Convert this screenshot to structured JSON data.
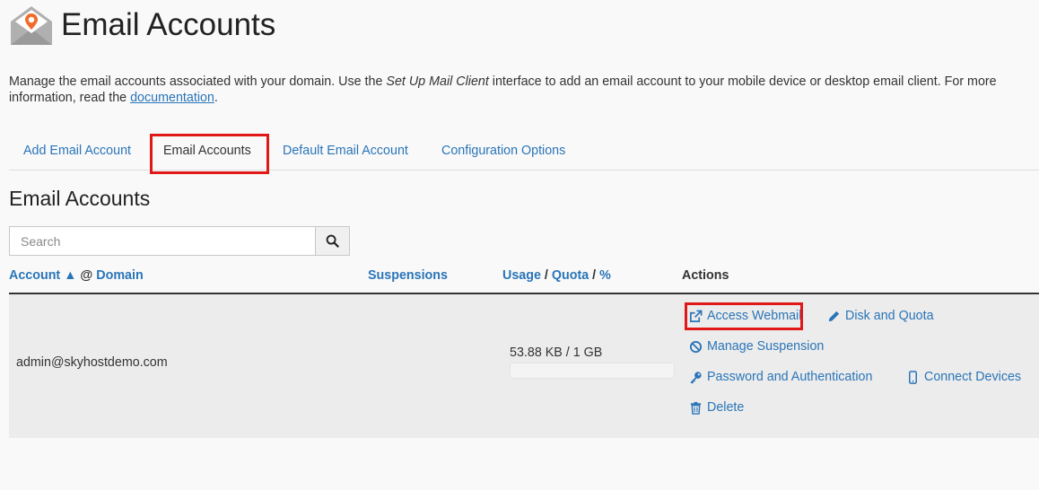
{
  "header": {
    "title": "Email Accounts"
  },
  "intro": {
    "text_before": "Manage the email accounts associated with your domain. Use the ",
    "italic": "Set Up Mail Client",
    "text_middle": " interface to add an email account to your mobile device or desktop email client. For more information, read the ",
    "link": "documentation",
    "text_after": "."
  },
  "tabs": [
    {
      "label": "Add Email Account"
    },
    {
      "label": "Email Accounts"
    },
    {
      "label": "Default Email Account"
    },
    {
      "label": "Configuration Options"
    }
  ],
  "section": {
    "title": "Email Accounts"
  },
  "search": {
    "placeholder": "Search",
    "value": ""
  },
  "columns": {
    "account": "Account",
    "sort_arrow": "▲",
    "at": "@",
    "domain": "Domain",
    "suspensions": "Suspensions",
    "usage": "Usage",
    "slash1": "/",
    "quota": "Quota",
    "slash2": "/",
    "percent": "%",
    "actions": "Actions"
  },
  "rows": [
    {
      "account": "admin@skyhostdemo.com",
      "usage_text": "53.88 KB / 1 GB",
      "usage_fraction": 0.0001,
      "actions": {
        "access_webmail": "Access Webmail",
        "disk_quota": "Disk and Quota",
        "manage_suspension": "Manage Suspension",
        "password_auth": "Password and Authentication",
        "connect_devices": "Connect Devices",
        "delete": "Delete"
      }
    }
  ],
  "colors": {
    "link": "#2a75b8",
    "highlight": "#e01818",
    "logo_orange": "#f26c29",
    "logo_gray": "#b0b0b0"
  }
}
